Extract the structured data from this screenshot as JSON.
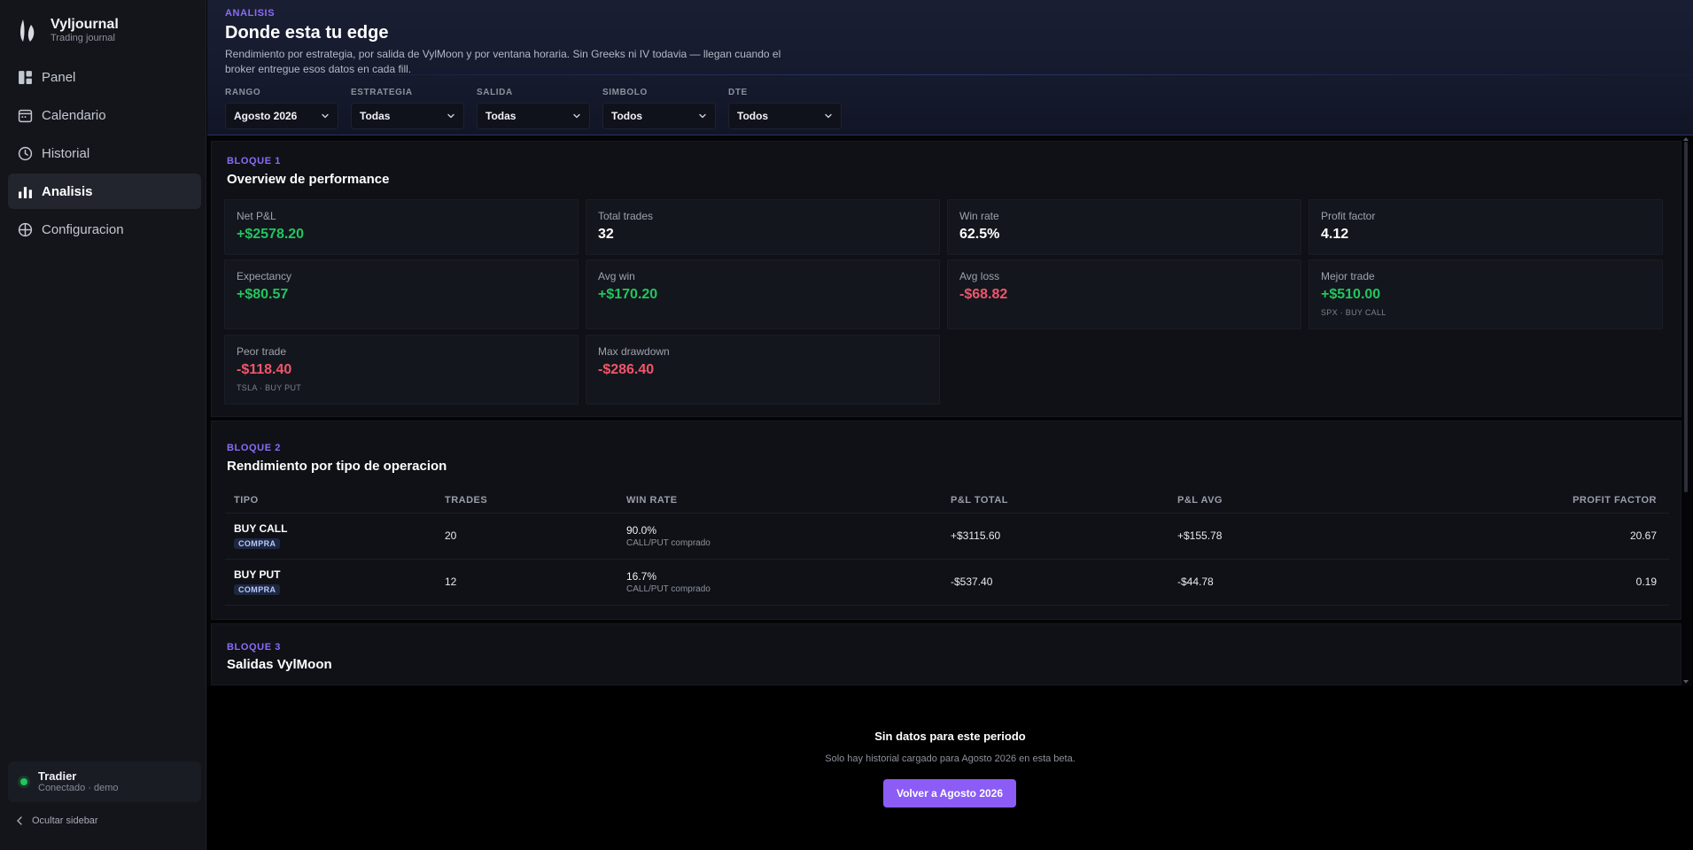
{
  "app": {
    "name": "Vyljournal",
    "tagline": "Trading journal"
  },
  "sidebar": {
    "items": [
      {
        "label": "Panel",
        "icon": "dashboard-icon",
        "active": false
      },
      {
        "label": "Calendario",
        "icon": "calendar-icon",
        "active": false
      },
      {
        "label": "Historial",
        "icon": "clock-icon",
        "active": false
      },
      {
        "label": "Analisis",
        "icon": "bar-chart-icon",
        "active": true
      },
      {
        "label": "Configuracion",
        "icon": "crosshair-icon",
        "active": false
      }
    ],
    "connection": {
      "broker": "Tradier",
      "status": "Conectado · demo",
      "color": "#22c55e"
    },
    "hide_label": "Ocultar sidebar"
  },
  "header": {
    "eyebrow": "ANALISIS",
    "title": "Donde esta tu edge",
    "description": "Rendimiento por estrategia, por salida de VylMoon y por ventana horaria. Sin Greeks ni IV todavia — llegan cuando el broker entregue esos datos en cada fill.",
    "filters": [
      {
        "label": "RANGO",
        "value": "Agosto 2026"
      },
      {
        "label": "ESTRATEGIA",
        "value": "Todas"
      },
      {
        "label": "SALIDA",
        "value": "Todas"
      },
      {
        "label": "SIMBOLO",
        "value": "Todos"
      },
      {
        "label": "DTE",
        "value": "Todos"
      }
    ]
  },
  "block1": {
    "tag": "BLOQUE 1",
    "title": "Overview de performance",
    "kpis": [
      {
        "label": "Net P&L",
        "value": "+$2578.20",
        "tone": "pos",
        "note": ""
      },
      {
        "label": "Total trades",
        "value": "32",
        "tone": "neutral",
        "note": ""
      },
      {
        "label": "Win rate",
        "value": "62.5%",
        "tone": "neutral",
        "note": ""
      },
      {
        "label": "Profit factor",
        "value": "4.12",
        "tone": "neutral",
        "note": ""
      },
      {
        "label": "Expectancy",
        "value": "+$80.57",
        "tone": "pos",
        "note": ""
      },
      {
        "label": "Avg win",
        "value": "+$170.20",
        "tone": "pos",
        "note": ""
      },
      {
        "label": "Avg loss",
        "value": "-$68.82",
        "tone": "neg",
        "note": ""
      },
      {
        "label": "Mejor trade",
        "value": "+$510.00",
        "tone": "pos",
        "note": "SPX · BUY CALL"
      },
      {
        "label": "Peor trade",
        "value": "-$118.40",
        "tone": "neg",
        "note": "TSLA · BUY PUT"
      },
      {
        "label": "Max drawdown",
        "value": "-$286.40",
        "tone": "neg",
        "note": ""
      }
    ]
  },
  "block2": {
    "tag": "BLOQUE 2",
    "title": "Rendimiento por tipo de operacion",
    "columns": [
      "TIPO",
      "TRADES",
      "WIN RATE",
      "P&L TOTAL",
      "P&L AVG",
      "PROFIT FACTOR"
    ],
    "rows": [
      {
        "tipo": "BUY CALL",
        "tag": "COMPRA",
        "trades": "20",
        "win_rate": "90.0%",
        "win_note": "CALL/PUT comprado",
        "pl_total": "+$3115.60",
        "pl_avg": "+$155.78",
        "profit_factor": "20.67",
        "tone": "pos"
      },
      {
        "tipo": "BUY PUT",
        "tag": "COMPRA",
        "trades": "12",
        "win_rate": "16.7%",
        "win_note": "CALL/PUT comprado",
        "pl_total": "-$537.40",
        "pl_avg": "-$44.78",
        "profit_factor": "0.19",
        "tone": "neg"
      }
    ]
  },
  "block3": {
    "tag": "BLOQUE 3",
    "title": "Salidas VylMoon"
  },
  "empty_state": {
    "title": "Sin datos para este periodo",
    "subtitle": "Solo hay historial cargado para Agosto 2026 en esta beta.",
    "cta": "Volver a Agosto 2026"
  },
  "colors": {
    "accent": "#8b5cf6",
    "positive": "#22c55e",
    "negative": "#f0566b"
  }
}
